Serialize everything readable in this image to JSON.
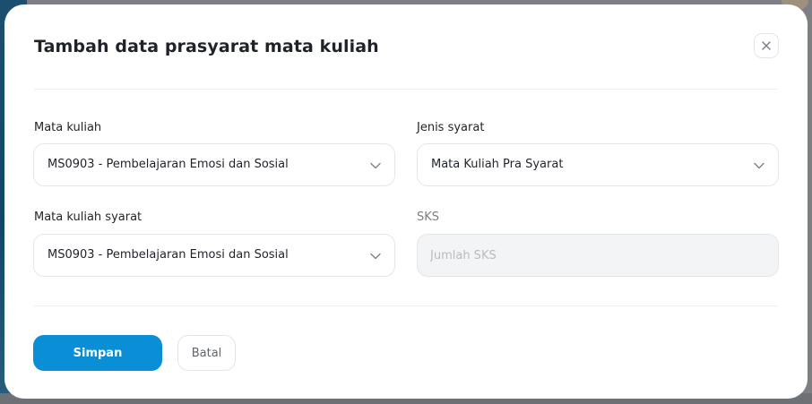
{
  "modal": {
    "title": "Tambah data prasyarat mata kuliah"
  },
  "form": {
    "mata_kuliah": {
      "label": "Mata kuliah",
      "value": "MS0903 - Pembelajaran Emosi dan Sosial"
    },
    "jenis_syarat": {
      "label": "Jenis syarat",
      "value": "Mata Kuliah Pra Syarat"
    },
    "mata_kuliah_syarat": {
      "label": "Mata kuliah syarat",
      "value": "MS0903 - Pembelajaran Emosi dan Sosial"
    },
    "sks": {
      "label": "SKS",
      "value": "",
      "placeholder": "Jumlah SKS"
    }
  },
  "actions": {
    "save_label": "Simpan",
    "cancel_label": "Batal"
  },
  "colors": {
    "primary": "#0a8fd6",
    "text": "#1f2329",
    "disabled_bg": "#f3f4f5"
  },
  "icons": {
    "close": "close-icon",
    "chevron": "chevron-down-icon"
  }
}
